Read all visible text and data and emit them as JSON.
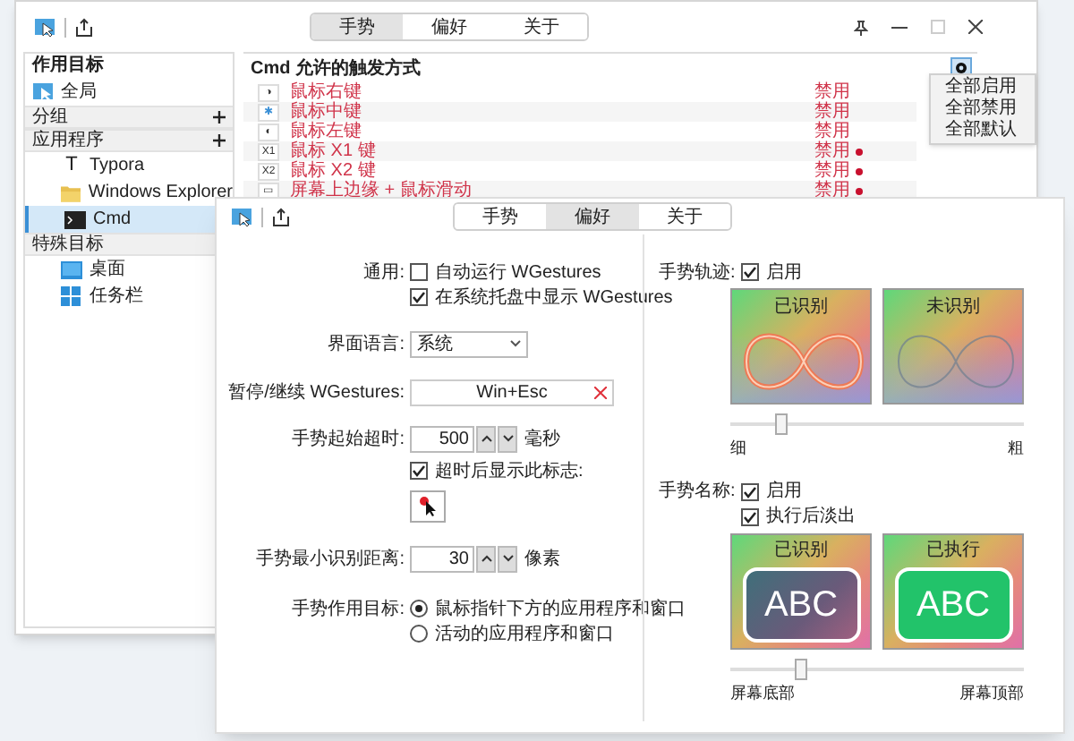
{
  "back_window": {
    "tabs": [
      {
        "label": "手势",
        "selected": true
      },
      {
        "label": "偏好",
        "selected": false
      },
      {
        "label": "关于",
        "selected": false
      }
    ],
    "targets": {
      "title": "作用目标",
      "items": [
        {
          "kind": "item",
          "label": "全局",
          "selected": false
        },
        {
          "kind": "group",
          "label": "分组",
          "add": true
        },
        {
          "kind": "group",
          "label": "应用程序",
          "add": true,
          "children": [
            {
              "kind": "item",
              "glyph": "T",
              "label": "Typora",
              "selected": false
            },
            {
              "kind": "item",
              "label": "Windows Explorer",
              "selected": false
            },
            {
              "kind": "item",
              "label": "Cmd",
              "selected": true
            }
          ]
        },
        {
          "kind": "group",
          "label": "特殊目标",
          "add": false,
          "children": [
            {
              "kind": "item",
              "label": "桌面",
              "selected": false
            },
            {
              "kind": "item",
              "label": "任务栏",
              "selected": false
            }
          ]
        }
      ]
    },
    "triggers": {
      "title": "Cmd 允许的触发方式",
      "rows": [
        {
          "icon": "◑",
          "label": "鼠标右键",
          "status": "禁用",
          "changed": false
        },
        {
          "icon": "✱",
          "label": "鼠标中键",
          "status": "禁用",
          "changed": false
        },
        {
          "icon": "◐",
          "label": "鼠标左键",
          "status": "禁用",
          "changed": false
        },
        {
          "icon": "X1",
          "label": "鼠标 X1 键",
          "status": "禁用",
          "changed": true
        },
        {
          "icon": "X2",
          "label": "鼠标 X2 键",
          "status": "禁用",
          "changed": true
        },
        {
          "icon": "▭",
          "label": "屏幕上边缘 + 鼠标滑动",
          "status": "禁用",
          "changed": true
        }
      ],
      "menu": [
        "全部启用",
        "全部禁用",
        "全部默认"
      ]
    }
  },
  "front_window": {
    "tabs": [
      {
        "label": "手势",
        "selected": false
      },
      {
        "label": "偏好",
        "selected": true
      },
      {
        "label": "关于",
        "selected": false
      }
    ],
    "general": {
      "label": "通用:",
      "options": [
        {
          "label": "自动运行 WGestures",
          "checked": false
        },
        {
          "label": "在系统托盘中显示 WGestures",
          "checked": true
        }
      ]
    },
    "language": {
      "label": "界面语言:",
      "value": "系统"
    },
    "pause_hotkey": {
      "label": "暂停/继续 WGestures:",
      "value": "Win+Esc"
    },
    "timeout": {
      "label": "手势起始超时:",
      "value": "500",
      "unit": "毫秒",
      "show_marker": {
        "label": "超时后显示此标志:",
        "checked": true
      }
    },
    "min_distance": {
      "label": "手势最小识别距离:",
      "value": "30",
      "unit": "像素"
    },
    "target": {
      "label": "手势作用目标:",
      "options": [
        {
          "label": "鼠标指针下方的应用程序和窗口",
          "selected": true
        },
        {
          "label": "活动的应用程序和窗口",
          "selected": false
        }
      ]
    },
    "trail": {
      "label": "手势轨迹:",
      "enabled": {
        "label": "启用",
        "checked": true
      },
      "previews": [
        {
          "kind": "recognized",
          "title": "已识别"
        },
        {
          "kind": "unrecognized",
          "title": "未识别"
        }
      ],
      "slider": {
        "level": 0.17,
        "min_label": "细",
        "max_label": "粗"
      }
    },
    "name": {
      "label": "手势名称:",
      "enabled": {
        "label": "启用",
        "checked": true
      },
      "fade": {
        "label": "执行后淡出",
        "checked": true
      },
      "previews": [
        {
          "kind": "recognized",
          "title": "已识别",
          "text": "ABC"
        },
        {
          "kind": "executed",
          "title": "已执行",
          "text": "ABC"
        }
      ],
      "slider": {
        "level": 0.24,
        "min_label": "屏幕底部",
        "max_label": "屏幕顶部"
      }
    }
  }
}
